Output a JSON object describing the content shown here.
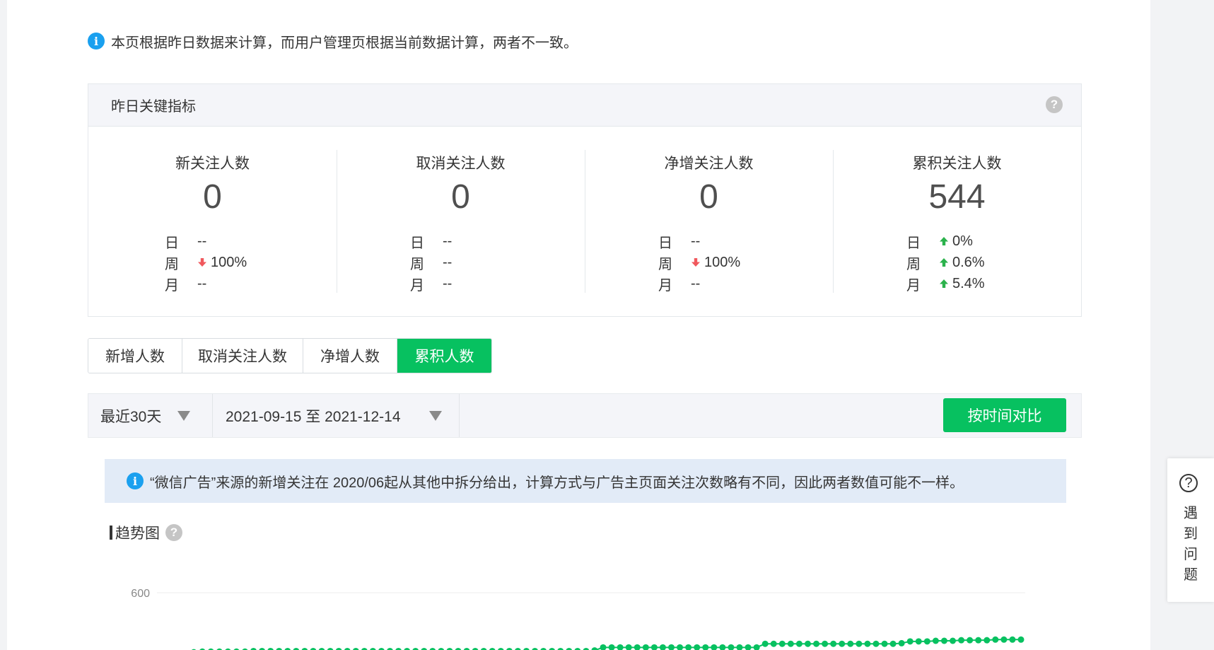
{
  "notice": {
    "text": "本页根据昨日数据来计算，而用户管理页根据当前数据计算，两者不一致。"
  },
  "kpi": {
    "title": "昨日关键指标",
    "columns": [
      {
        "title": "新关注人数",
        "value": "0",
        "rows": [
          {
            "label": "日",
            "text": "--",
            "dir": ""
          },
          {
            "label": "周",
            "text": "100%",
            "dir": "down"
          },
          {
            "label": "月",
            "text": "--",
            "dir": ""
          }
        ]
      },
      {
        "title": "取消关注人数",
        "value": "0",
        "rows": [
          {
            "label": "日",
            "text": "--",
            "dir": ""
          },
          {
            "label": "周",
            "text": "--",
            "dir": ""
          },
          {
            "label": "月",
            "text": "--",
            "dir": ""
          }
        ]
      },
      {
        "title": "净增关注人数",
        "value": "0",
        "rows": [
          {
            "label": "日",
            "text": "--",
            "dir": ""
          },
          {
            "label": "周",
            "text": "100%",
            "dir": "down"
          },
          {
            "label": "月",
            "text": "--",
            "dir": ""
          }
        ]
      },
      {
        "title": "累积关注人数",
        "value": "544",
        "rows": [
          {
            "label": "日",
            "text": "0%",
            "dir": "up"
          },
          {
            "label": "周",
            "text": "0.6%",
            "dir": "up"
          },
          {
            "label": "月",
            "text": "5.4%",
            "dir": "up"
          }
        ]
      }
    ]
  },
  "tabs": [
    {
      "label": "新增人数",
      "active": false
    },
    {
      "label": "取消关注人数",
      "active": false
    },
    {
      "label": "净增人数",
      "active": false
    },
    {
      "label": "累积人数",
      "active": true
    }
  ],
  "filter": {
    "period": "最近30天",
    "range": "2021-09-15 至 2021-12-14",
    "compare_button": "按时间对比"
  },
  "ad_notice": "“微信广告”来源的新增关注在 2020/06起从其他中拆分给出，计算方式与广告主页面关注次数略有不同，因此两者数值可能不一样。",
  "trend": {
    "title": "趋势图"
  },
  "colors": {
    "accent": "#07c160",
    "up": "#2bb24c",
    "down": "#f0585d",
    "info": "#1aa0ef"
  },
  "chart_data": {
    "type": "line",
    "x_range": [
      "2021-09-15",
      "2021-12-14"
    ],
    "y_tick_labels": [
      "600"
    ],
    "series": [
      {
        "values": [
          485,
          485,
          501,
          502,
          502,
          502,
          502,
          502,
          502,
          503,
          503,
          503,
          503,
          503,
          503,
          503,
          503,
          503,
          503,
          503,
          503,
          503,
          503,
          503,
          503,
          503,
          503,
          503,
          503,
          503,
          503,
          503,
          503,
          503,
          503,
          503,
          503,
          503,
          503,
          503,
          503,
          503,
          503,
          503,
          503,
          503,
          503,
          503,
          503,
          504,
          509,
          509,
          509,
          509,
          509,
          509,
          509,
          509,
          509,
          509,
          509,
          509,
          509,
          509,
          509,
          509,
          509,
          509,
          509,
          515,
          515,
          515,
          515,
          515,
          515,
          515,
          515,
          515,
          515,
          515,
          515,
          515,
          515,
          515,
          515,
          516,
          519,
          519,
          519,
          520,
          520,
          520,
          521,
          521,
          521,
          521,
          522,
          522,
          522,
          522
        ]
      }
    ]
  },
  "float_help": {
    "label": "遇到问题"
  }
}
